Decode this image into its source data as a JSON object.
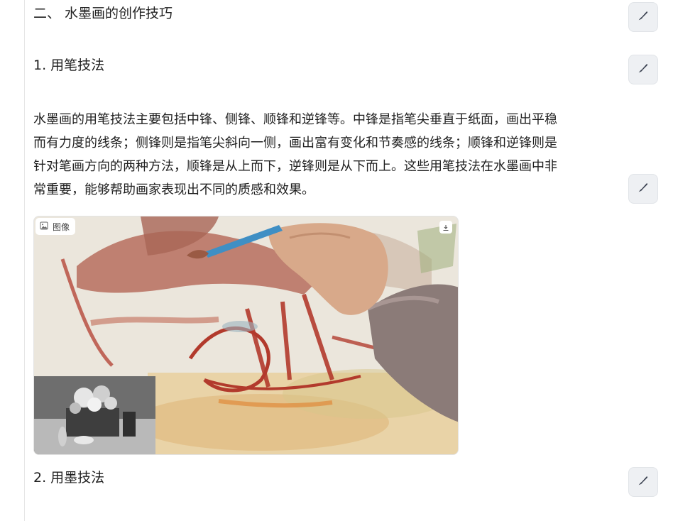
{
  "section": {
    "heading": "二、 水墨画的创作技巧"
  },
  "subsection1": {
    "heading": "1. 用笔技法",
    "paragraph_lines": [
      "水墨画的用笔技法主要包括中锋、侧锋、顺锋和逆锋等。中锋是指笔尖垂直于纸面，画出平稳",
      "而有力度的线条；侧锋则是指笔尖斜向一侧，画出富有变化和节奏感的线条；顺锋和逆锋则是",
      "针对笔画方向的两种方法，顺锋是从上而下，逆锋则是从下而上。这些用笔技法在水墨画中非",
      "常重要，能够帮助画家表现出不同的质感和效果。"
    ]
  },
  "image": {
    "tag_label": "图像",
    "tag_icon": "image-icon",
    "download_icon": "download-icon"
  },
  "subsection2": {
    "heading": "2. 用墨技法"
  },
  "edit_icon": "brush-icon",
  "colors": {
    "button_bg": "#eef0f3",
    "text": "#1f1f1f",
    "rule": "#e6e6e6"
  }
}
